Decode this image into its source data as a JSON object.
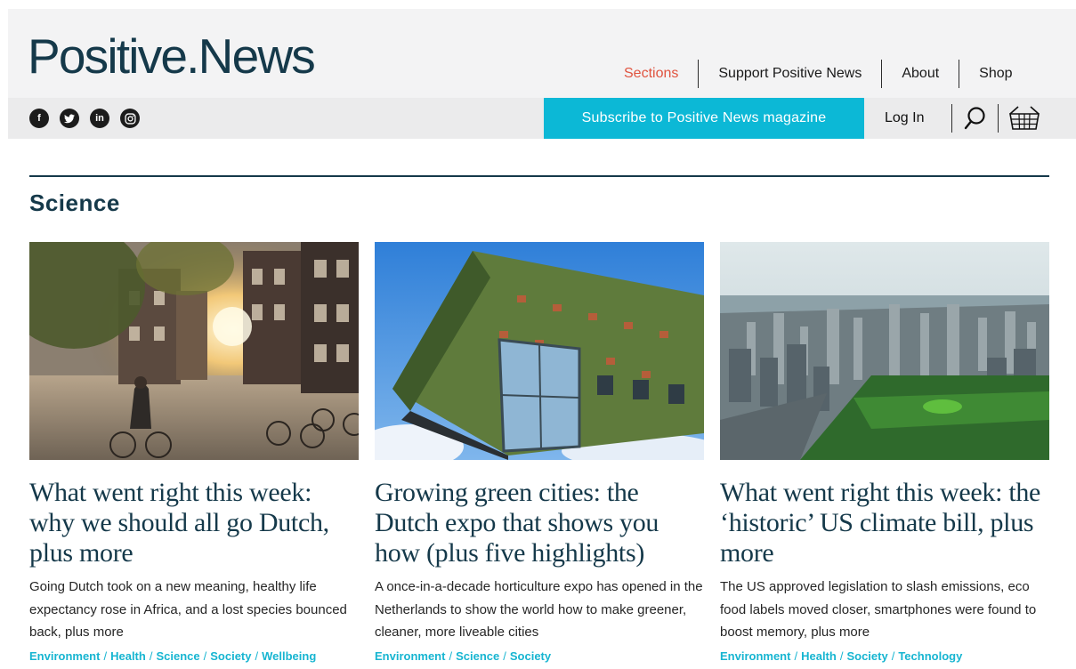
{
  "header": {
    "logo": "Positive.News",
    "nav": {
      "sections": "Sections",
      "support": "Support Positive News",
      "about": "About",
      "shop": "Shop"
    },
    "social": [
      {
        "name": "facebook-icon",
        "glyph": "f"
      },
      {
        "name": "twitter-icon",
        "glyph": "t"
      },
      {
        "name": "linkedin-icon",
        "glyph": "in"
      },
      {
        "name": "instagram-icon",
        "glyph": "◎"
      }
    ],
    "subscribe": "Subscribe to Positive News magazine",
    "login": "Log In",
    "icons": [
      "search-icon",
      "basket-icon"
    ]
  },
  "section": {
    "title": "Science"
  },
  "articles": [
    {
      "title": "What went right this week: why we should all go Dutch, plus more",
      "summary": "Going Dutch took on a new meaning, healthy life expectancy rose in Africa, and a lost species bounced back, plus more",
      "tags": [
        "Environment",
        "Health",
        "Science",
        "Society",
        "Wellbeing"
      ]
    },
    {
      "title": "Growing green cities: the Dutch expo that shows you how (plus five highlights)",
      "summary": "A once-in-a-decade horticulture expo has opened in the Netherlands to show the world how to make greener, cleaner, more liveable cities",
      "tags": [
        "Environment",
        "Science",
        "Society"
      ]
    },
    {
      "title": "What went right this week: the ‘historic’ US climate bill, plus more",
      "summary": "The US approved legislation to slash emissions, eco food labels moved closer, smartphones were found to boost memory, plus more",
      "tags": [
        "Environment",
        "Health",
        "Society",
        "Technology"
      ]
    }
  ],
  "colors": {
    "brand": "#15394a",
    "accent": "#0cb8d6",
    "active_nav": "#e0533f",
    "tag": "#17b5d1"
  }
}
